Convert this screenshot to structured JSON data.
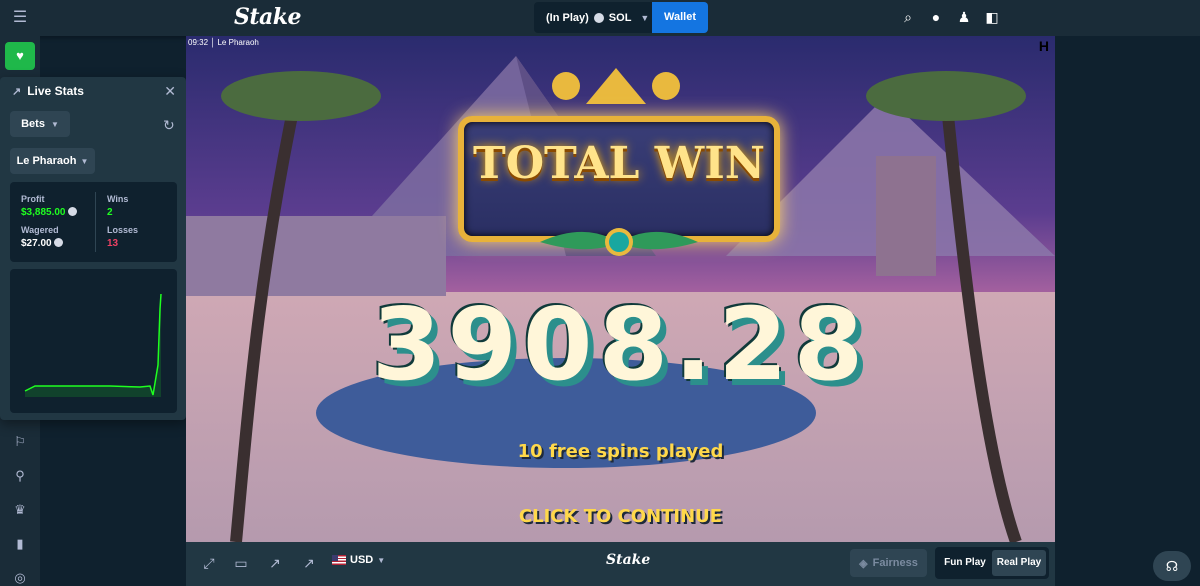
{
  "header": {
    "logo": "Stake",
    "balance_label": "(In Play)",
    "currency": "SOL",
    "wallet_label": "Wallet"
  },
  "live_stats": {
    "title": "Live Stats",
    "bets_dropdown": "Bets",
    "game_dropdown": "Le Pharaoh",
    "profit_label": "Profit",
    "profit_value": "$3,885.00",
    "wagered_label": "Wagered",
    "wagered_value": "$27.00",
    "wins_label": "Wins",
    "wins_value": "2",
    "losses_label": "Losses",
    "losses_value": "13"
  },
  "game": {
    "time_label": "09:32",
    "game_title": "Le Pharaoh",
    "win_title": "TOTAL WIN",
    "win_amount": "3908.28",
    "spins_text": "10 free spins played",
    "continue_text": "CLICK TO CONTINUE",
    "h_mark": "H"
  },
  "gamebar": {
    "currency_label": "USD",
    "logo": "Stake",
    "fairness_label": "Fairness",
    "fun_play_label": "Fun Play",
    "real_play_label": "Real Play"
  },
  "colors": {
    "accent_blue": "#1475e1",
    "casino_green": "#1fb84a",
    "profit_green": "#1fff20",
    "loss_red": "#ed4163"
  }
}
